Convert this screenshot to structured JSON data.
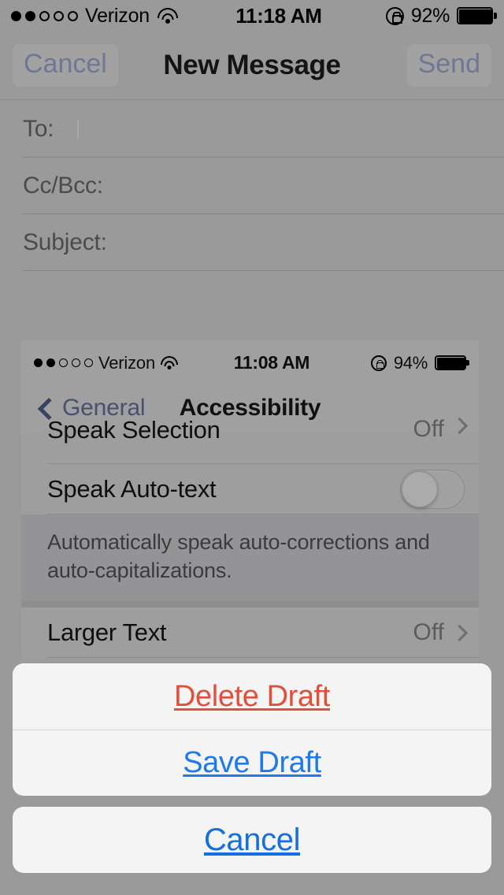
{
  "status_bar": {
    "signal_dots_filled": 2,
    "signal_dots_total": 5,
    "carrier": "Verizon",
    "wifi_icon": "wifi-icon",
    "time": "11:18 AM",
    "rotation_lock_icon": "rotation-lock-icon",
    "battery_percent": "92%",
    "battery_fill": 92,
    "battery_icon": "battery-full-icon"
  },
  "nav_bar": {
    "cancel_label": "Cancel",
    "title": "New Message",
    "send_label": "Send"
  },
  "compose": {
    "fields": [
      {
        "label": "To:",
        "value": "",
        "placeholder": ""
      },
      {
        "label": "Cc/Bcc:",
        "value": "",
        "placeholder": ""
      },
      {
        "label": "Subject:",
        "value": "",
        "placeholder": ""
      }
    ]
  },
  "attachment": {
    "kind": "screenshot-attachment",
    "status_bar": {
      "signal_dots_filled": 2,
      "signal_dots_total": 5,
      "carrier": "Verizon",
      "wifi_icon": "wifi-icon",
      "time": "11:08 AM",
      "rotation_lock_icon": "rotation-lock-icon",
      "battery_percent": "94%",
      "battery_fill": 94,
      "battery_icon": "battery-full-icon"
    },
    "nav_bar": {
      "back_icon": "chevron-left-icon",
      "back_label": "General",
      "title": "Accessibility"
    },
    "rows": [
      {
        "label": "Speak Selection",
        "value": "Off",
        "accessory": "chevron-right-icon",
        "clipped": true
      },
      {
        "label": "Speak Auto-text",
        "accessory": "toggle",
        "toggle_on": false
      }
    ],
    "note": "Automatically speak auto-corrections and auto-capitalizations.",
    "rows_after_note": [
      {
        "label": "Larger Text",
        "value": "Off",
        "accessory": "chevron-right-icon"
      }
    ]
  },
  "action_sheet": {
    "buttons": [
      {
        "label": "Delete Draft",
        "style": "destructive"
      },
      {
        "label": "Save Draft",
        "style": "normal"
      }
    ],
    "cancel_label": "Cancel"
  },
  "colors": {
    "destructive": "#e0503a",
    "link": "#1e7aeb",
    "cancel": "#1470e0",
    "nav_tint_dimmed": "#6f7795",
    "inner_nav_tint": "#2f4fc9",
    "backdrop": "#9a9a9a",
    "sheet_bg": "#f4f4f4"
  }
}
